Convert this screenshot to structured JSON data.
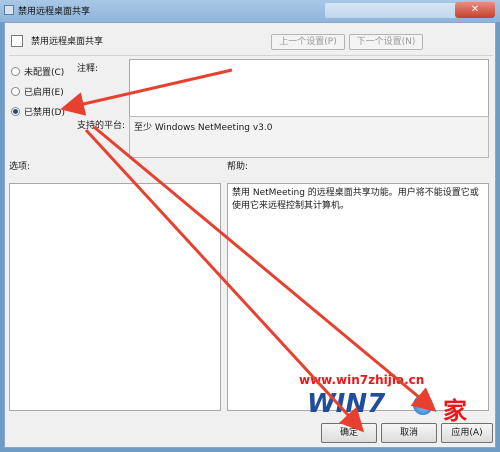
{
  "window": {
    "title": "禁用远程桌面共享"
  },
  "header": {
    "title": "禁用远程桌面共享",
    "prev_label": "上一个设置(P)",
    "next_label": "下一个设置(N)"
  },
  "options": [
    {
      "label": "未配置(C)",
      "checked": false
    },
    {
      "label": "已启用(E)",
      "checked": false
    },
    {
      "label": "已禁用(D)",
      "checked": true
    }
  ],
  "comment": {
    "label": "注释:",
    "value": ""
  },
  "platform": {
    "label": "支持的平台:",
    "value": "至少 Windows NetMeeting v3.0"
  },
  "options_section": {
    "label": "选项:"
  },
  "help_section": {
    "label": "帮助:",
    "text": "禁用 NetMeeting 的远程桌面共享功能。用户将不能设置它或使用它来远程控制其计算机。"
  },
  "buttons": {
    "ok": "确定",
    "cancel": "取消",
    "apply": "应用(A)"
  },
  "watermark": {
    "url": "www.win7zhijia.cn",
    "brand": "WIN7",
    "suffix": "家"
  },
  "colors": {
    "arrow": "#e8402f",
    "accent": "#2a4d7a",
    "watermark_red": "#e8191b",
    "watermark_blue": "#1f4e9c"
  }
}
